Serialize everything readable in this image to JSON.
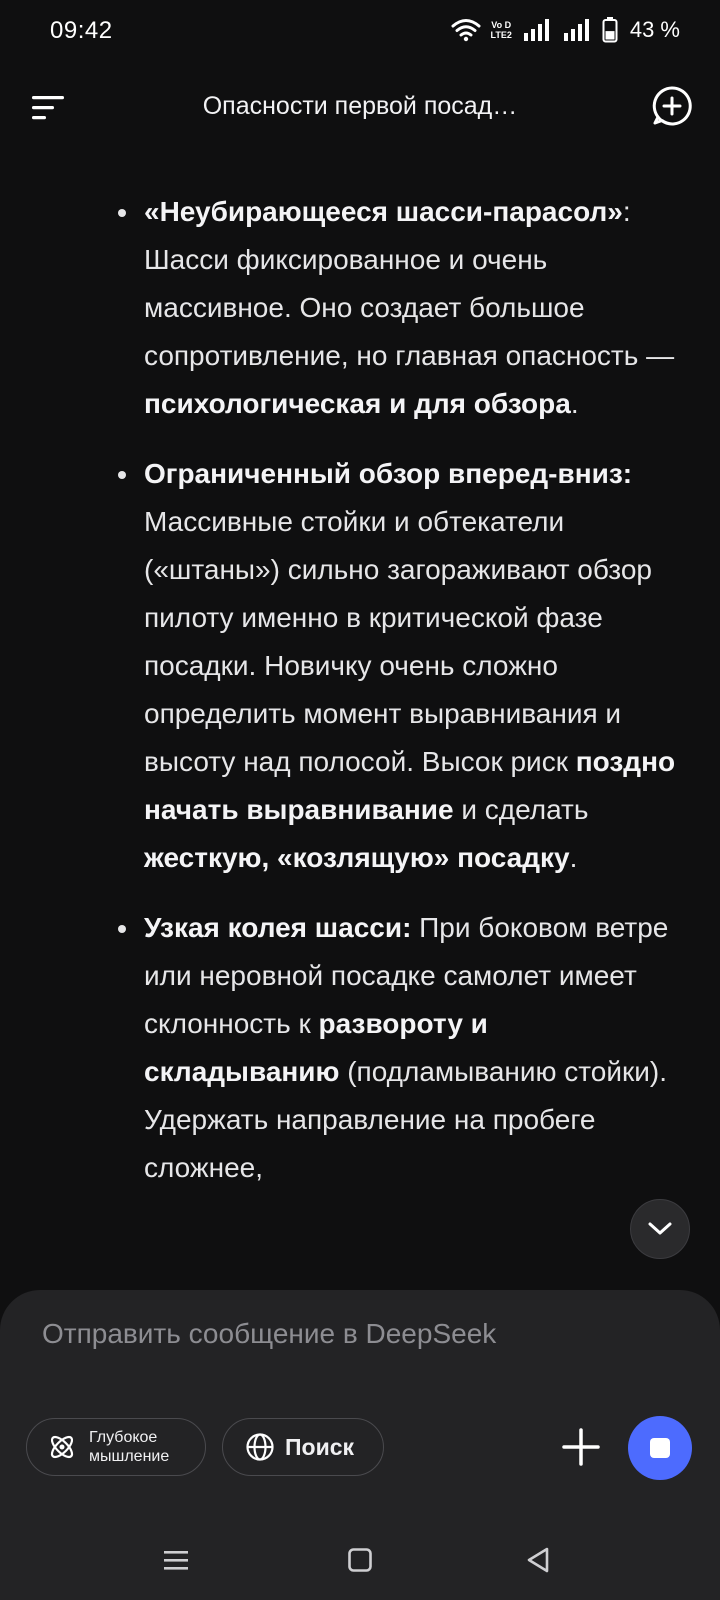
{
  "status_bar": {
    "time": "09:42",
    "volte_top": "Vo D",
    "volte_bottom": "LTE2",
    "battery_percent": "43 %",
    "battery_level": 0.43
  },
  "header": {
    "title": "Опасности первой посад…"
  },
  "message": {
    "items": [
      {
        "p1_bold": "«Неубирающееся шасси-парасол»",
        "p2": ": Шасси фиксированное и очень массивное. Оно создает большое сопротивление, но главная опасность — ",
        "p3_bold": "психологическая и для обзора",
        "p4": "."
      },
      {
        "p1_bold": "Ограниченный обзор вперед-вниз:",
        "p2": " Массивные стойки и обтекатели («штаны») сильно загораживают обзор пилоту именно в критической фазе посадки. Новичку очень сложно определить момент выравнивания и высоту над полосой. Высок риск ",
        "p3_bold": "поздно начать выравнивание",
        "p4": " и сделать ",
        "p5_bold": "жесткую, «козлящую» посадку",
        "p6": "."
      },
      {
        "p1_bold": "Узкая колея шасси:",
        "p2": " При боковом ветре или неровной посадке самолет имеет склонность к ",
        "p3_bold": "развороту и складыванию",
        "p4": " (подламыванию стойки). Удержать направление на пробеге сложнее,"
      }
    ]
  },
  "composer": {
    "placeholder": "Отправить сообщение в DeepSeek",
    "deep_think_label_line1": "Глубокое",
    "deep_think_label_line2": "мышление",
    "search_label": "Поиск"
  },
  "colors": {
    "background": "#0f0f10",
    "composer": "#232325",
    "accent": "#4d6bfe",
    "text": "#e6e6e8"
  },
  "icons": {
    "menu": "menu-icon",
    "new_chat": "new-chat-icon",
    "scroll_down": "chevron-down-icon",
    "deep_think": "atom-icon",
    "search": "globe-icon",
    "attach": "plus-icon",
    "stop": "stop-icon",
    "nav_recent": "recent-apps-icon",
    "nav_home": "home-icon",
    "nav_back": "back-icon"
  }
}
